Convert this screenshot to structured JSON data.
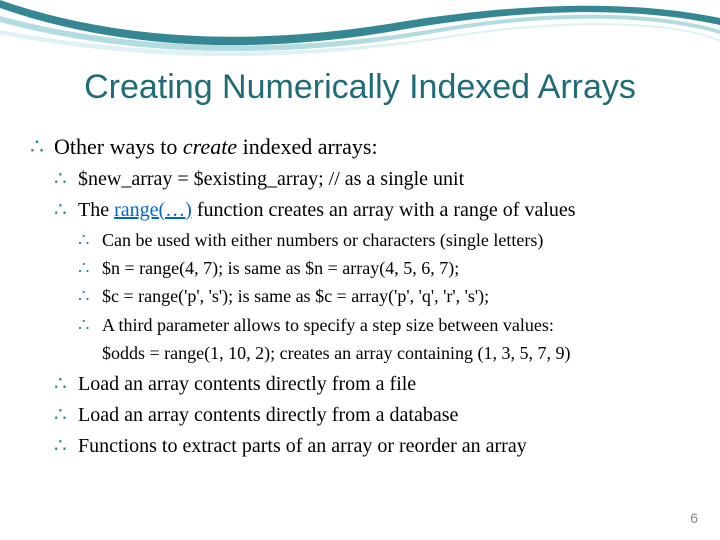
{
  "title": "Creating Numerically Indexed Arrays",
  "lvl1": {
    "pre": "Other ways to ",
    "em": "create",
    "post": " indexed arrays:"
  },
  "sub1": "$new_array = $existing_array; // as a single unit",
  "sub2": {
    "pre": "The ",
    "link": "range(…)",
    "post": " function creates an array with a range of values"
  },
  "sub2a": "Can be used with either numbers or characters (single letters)",
  "sub2b": "$n = range(4, 7); is same as $n = array(4, 5, 6, 7);",
  "sub2c": "$c = range('p', 's'); is same as $c = array('p', 'q', 'r', 's');",
  "sub2d": "A third parameter allows to specify a step size between values:",
  "sub2d_code": "$odds = range(1, 10, 2); creates an array containing (1, 3, 5, 7, 9)",
  "sub3": "Load an array contents directly from a file",
  "sub4": "Load an array contents directly from a database",
  "sub5": "Functions to extract parts of an array or reorder an array",
  "page_number": "6",
  "bullet_glyph": "∴"
}
